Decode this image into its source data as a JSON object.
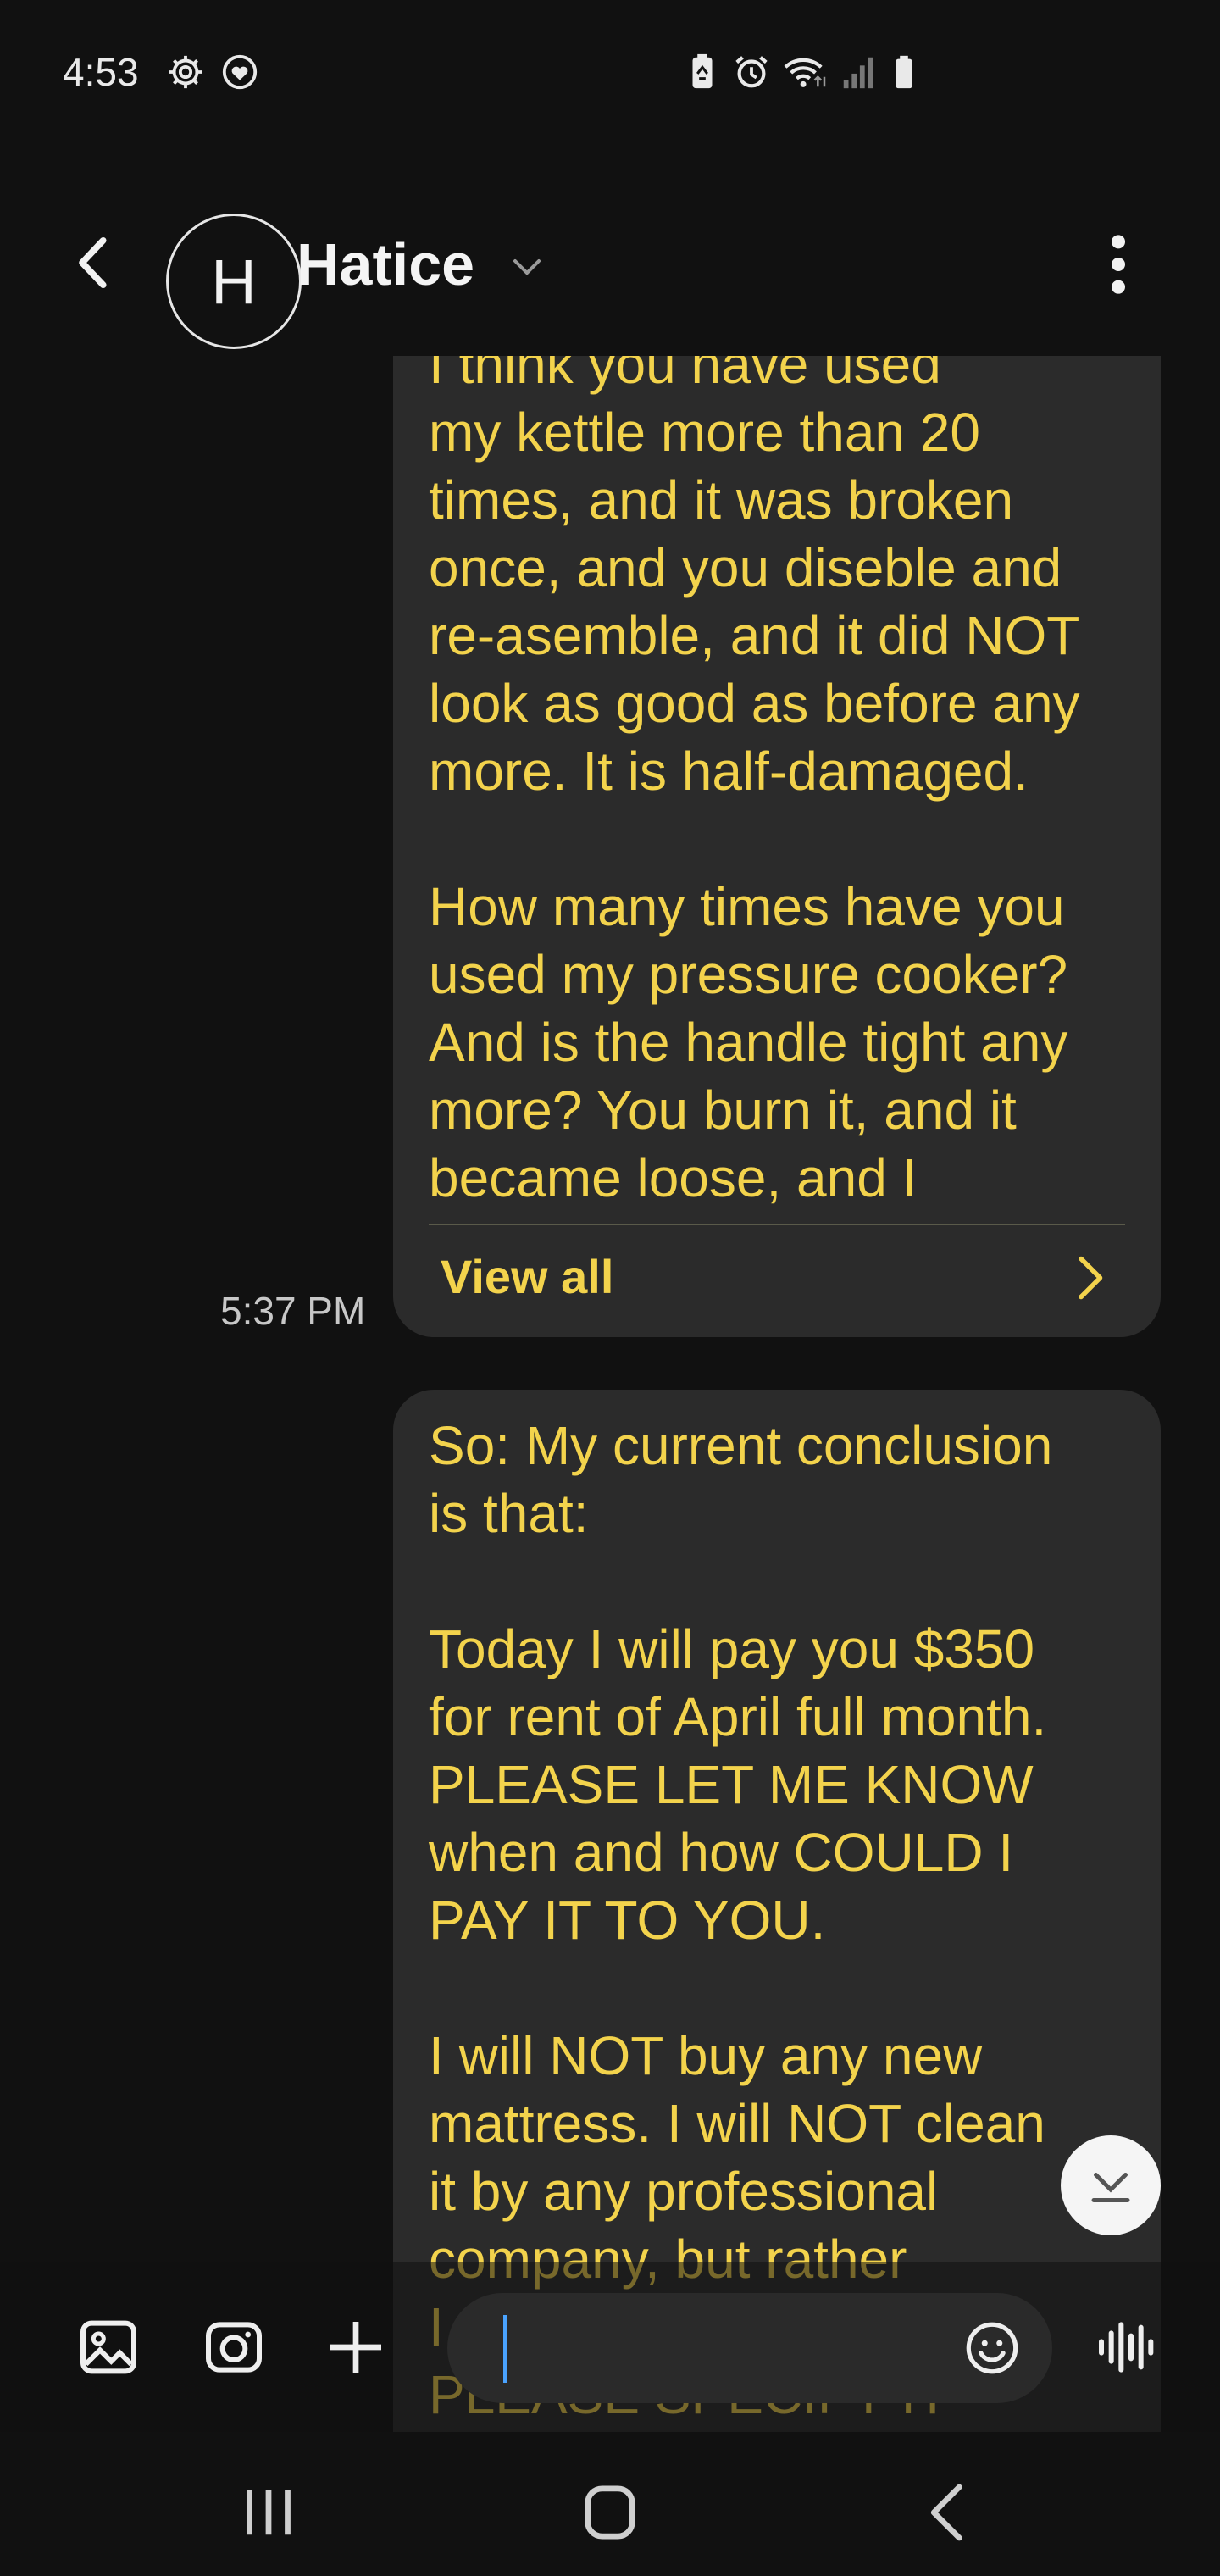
{
  "status_bar": {
    "time": "4:53",
    "left_icons": [
      "gear-icon",
      "heart-shield-icon"
    ],
    "right_icons": [
      "battery-saver-icon",
      "alarm-icon",
      "wifi-icon",
      "signal-icon",
      "battery-icon"
    ]
  },
  "header": {
    "avatar_letter": "H",
    "contact_name": "Hatice"
  },
  "messages": [
    {
      "text": "I think you have used\nmy kettle more than 20\ntimes, and it was broken\nonce, and you diseble and\nre-asemble, and it did NOT\nlook as good as before any\nmore. It is half-damaged.\n\nHow many times have you\nused my pressure cooker?\nAnd is the handle tight any\nmore? You burn it, and it\nbecame loose, and I",
      "view_all_label": "View all",
      "timestamp": "5:37 PM"
    },
    {
      "text": "So: My current conclusion\nis that:\n\nToday I will pay you $350\nfor rent of April full month.\nPLEASE LET ME KNOW\nwhen and how COULD I\nPAY IT TO YOU.\n\nI will NOT buy any new\nmattress. I will NOT clean\nit by any professional\ncompany, but rather\nI...\nPLEASE SPECIFY IT"
    }
  ],
  "composer": {
    "placeholder": ""
  },
  "colors": {
    "background": "#111111",
    "bubble": "#2b2b2b",
    "message_text": "#f3d34c",
    "caret": "#4aa3ff"
  }
}
